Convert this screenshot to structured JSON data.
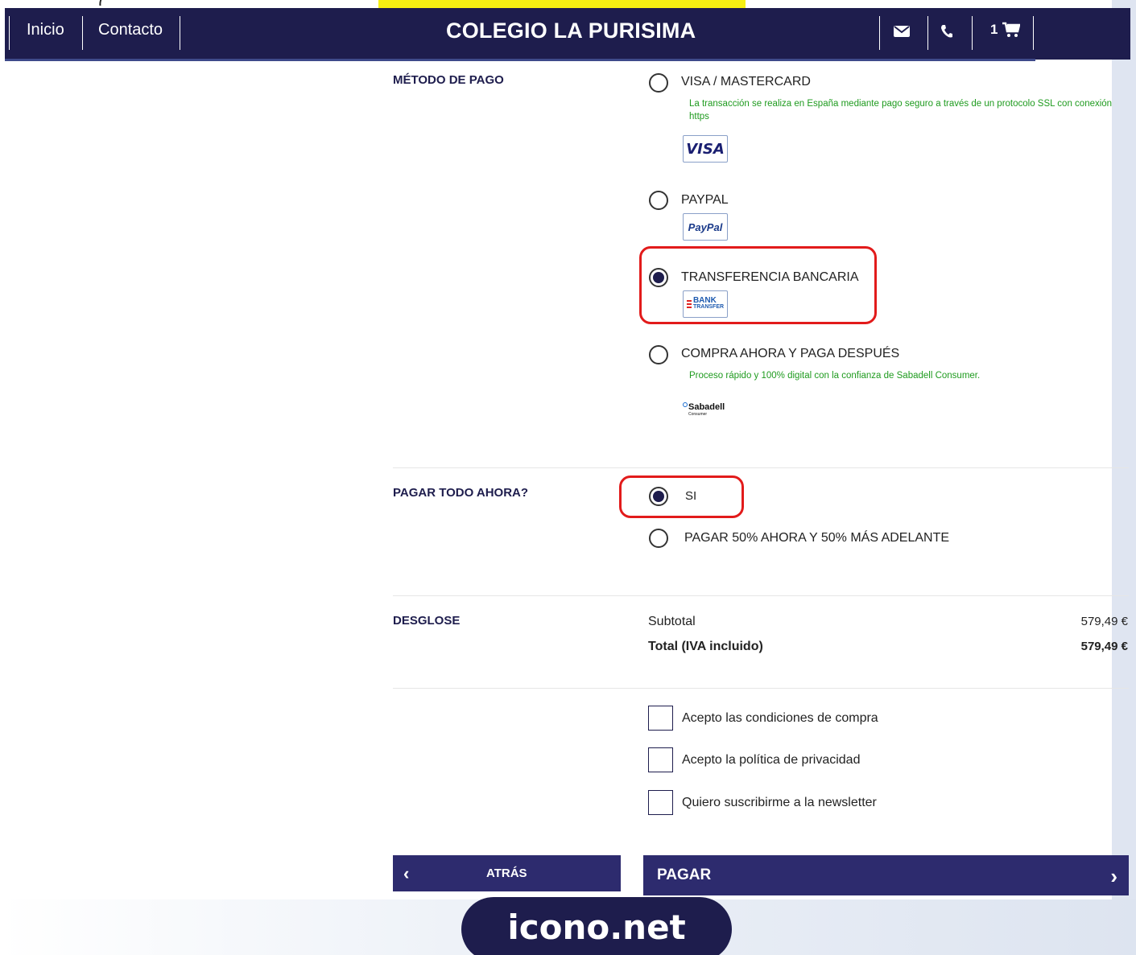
{
  "nav": {
    "links": [
      "Inicio",
      "Contacto"
    ],
    "brand": "COLEGIO LA PURISIMA",
    "cart_count": "1",
    "icons": [
      "envelope-icon",
      "phone-icon",
      "cart-icon"
    ],
    "top_cut_text": "(",
    "colors": {
      "bar": "#1e1d4d",
      "accent_highlight": "#f5ef12"
    }
  },
  "payment": {
    "label": "MÉTODO DE PAGO",
    "options": [
      {
        "label": "VISA / MASTERCARD",
        "note": "La transacción se realiza en España mediante pago seguro a través de un protocolo SSL con conexión https",
        "logo": "VISA",
        "selected": false
      },
      {
        "label": "PAYPAL",
        "logo": "PayPal",
        "selected": false
      },
      {
        "label": "TRANSFERENCIA BANCARIA",
        "logo": "BANK TRANSFER",
        "logo_top": "BANK",
        "logo_bottom": "TRANSFER",
        "selected": true
      },
      {
        "label": "COMPRA AHORA Y PAGA DESPUÉS",
        "note": "Proceso rápido y 100% digital con la confianza de Sabadell Consumer.",
        "logo": "Sabadell Consumer",
        "logo_top": "Sabadell",
        "logo_bottom": "Consumer",
        "selected": false
      }
    ]
  },
  "pay_now": {
    "label": "PAGAR TODO AHORA?",
    "options": [
      {
        "label": "SI",
        "selected": true
      },
      {
        "label": "PAGAR 50% AHORA Y 50% MÁS ADELANTE",
        "selected": false
      }
    ]
  },
  "breakdown": {
    "label": "DESGLOSE",
    "subtotal_label": "Subtotal",
    "subtotal_value": "579,49 €",
    "total_label": "Total (IVA incluido)",
    "total_value": "579,49 €"
  },
  "checkboxes": [
    {
      "label": "Acepto las condiciones de compra",
      "checked": false
    },
    {
      "label": "Acepto la política de privacidad",
      "checked": false
    },
    {
      "label": "Quiero suscribirme a la newsletter",
      "checked": false
    }
  ],
  "buttons": {
    "back": "ATRÁS",
    "pay": "PAGAR"
  },
  "watermark": "icono.net"
}
